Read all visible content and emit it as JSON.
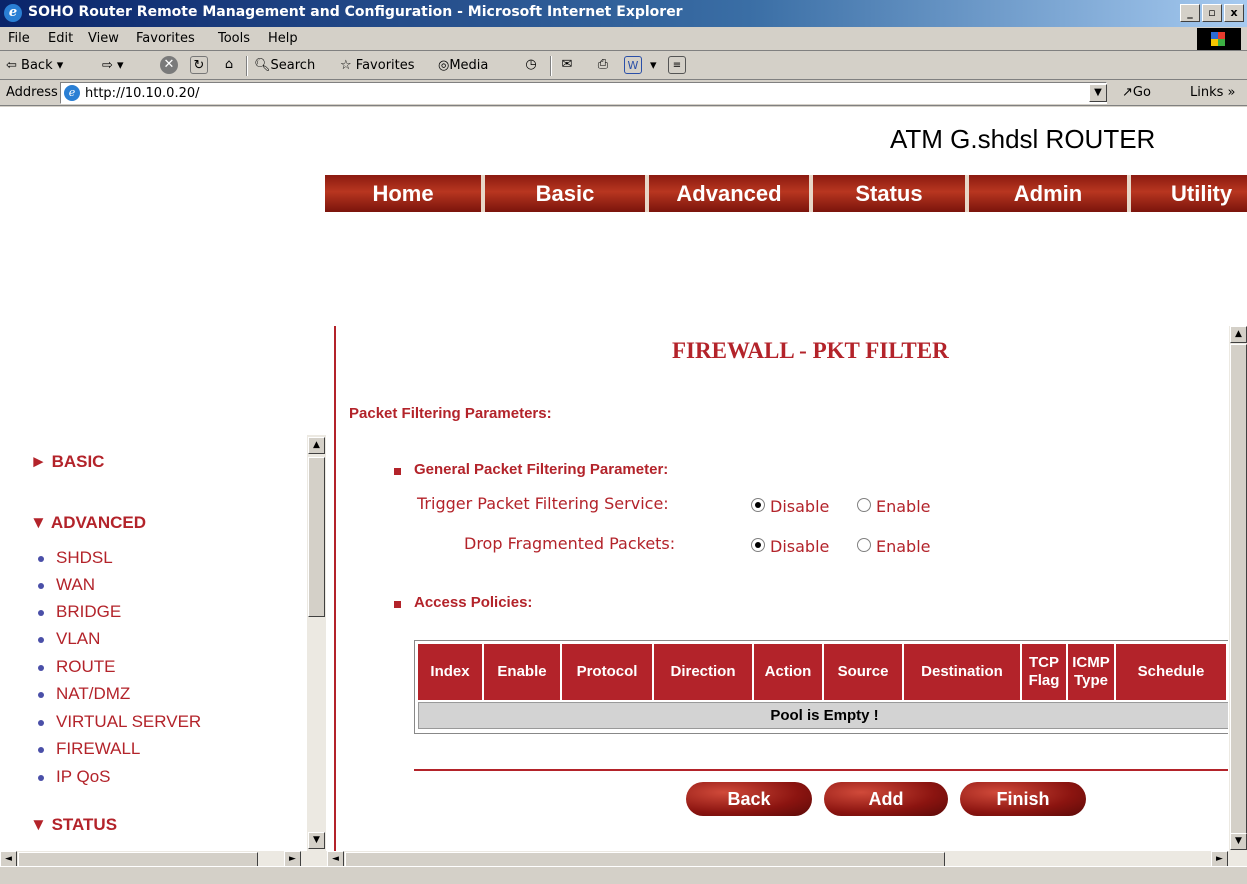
{
  "window": {
    "title": "SOHO Router Remote Management and Configuration - Microsoft Internet Explorer",
    "controls": [
      "minimize",
      "maximize",
      "close"
    ]
  },
  "menubar": [
    "File",
    "Edit",
    "View",
    "Favorites",
    "Tools",
    "Help"
  ],
  "toolbar": {
    "back": "Back",
    "search": "Search",
    "favorites": "Favorites",
    "media": "Media"
  },
  "address": {
    "label": "Address",
    "url": "http://10.10.0.20/",
    "go": "Go",
    "links": "Links"
  },
  "router": {
    "title": "ATM G.shdsl ROUTER"
  },
  "nav_tabs": [
    "Home",
    "Basic",
    "Advanced",
    "Status",
    "Admin",
    "Utility"
  ],
  "sidebar": {
    "basic": "BASIC",
    "advanced": "ADVANCED",
    "advanced_items": [
      "SHDSL",
      "WAN",
      "BRIDGE",
      "VLAN",
      "ROUTE",
      "NAT/DMZ",
      "VIRTUAL SERVER",
      "FIREWALL",
      "IP QoS"
    ],
    "status": "STATUS"
  },
  "main": {
    "heading": "FIREWALL - PKT FILTER",
    "section_title": "Packet Filtering Parameters:",
    "general_title": "General Packet Filtering Parameter:",
    "trigger_label": "Trigger Packet Filtering Service:",
    "drop_label": "Drop Fragmented Packets:",
    "disable": "Disable",
    "enable": "Enable",
    "trigger_value": "Disable",
    "drop_value": "Disable",
    "access_title": "Access Policies:",
    "table": {
      "headers": [
        "Index",
        "Enable",
        "Protocol",
        "Direction",
        "Action",
        "Source",
        "Destination",
        "TCP Flag",
        "ICMP Type",
        "Schedule"
      ],
      "empty_message": "Pool is Empty !"
    },
    "buttons": {
      "back": "Back",
      "add": "Add",
      "finish": "Finish"
    }
  },
  "colors": {
    "accent": "#b3232a",
    "nav_bg": "#9a2416",
    "title_bar": "#0a246a"
  }
}
